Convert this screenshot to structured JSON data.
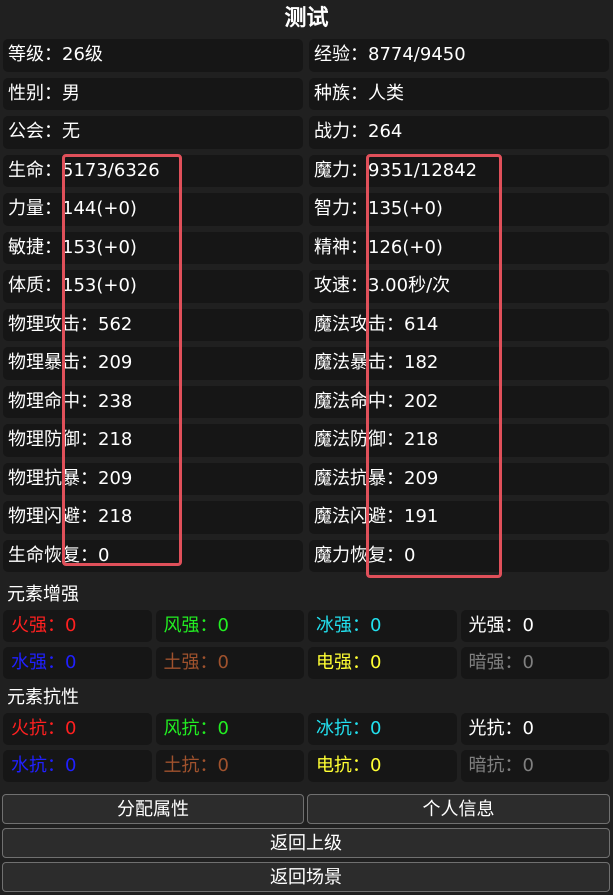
{
  "title": "测试",
  "stats": [
    [
      {
        "label": "等级",
        "value": "26级"
      },
      {
        "label": "经验",
        "value": "8774/9450"
      }
    ],
    [
      {
        "label": "性别",
        "value": "男"
      },
      {
        "label": "种族",
        "value": "人类"
      }
    ],
    [
      {
        "label": "公会",
        "value": "无"
      },
      {
        "label": "战力",
        "value": "264"
      }
    ],
    [
      {
        "label": "生命",
        "value": "5173/6326"
      },
      {
        "label": "魔力",
        "value": "9351/12842"
      }
    ],
    [
      {
        "label": "力量",
        "value": "144(+0)"
      },
      {
        "label": "智力",
        "value": "135(+0)"
      }
    ],
    [
      {
        "label": "敏捷",
        "value": "153(+0)"
      },
      {
        "label": "精神",
        "value": "126(+0)"
      }
    ],
    [
      {
        "label": "体质",
        "value": "153(+0)"
      },
      {
        "label": "攻速",
        "value": "3.00秒/次"
      }
    ],
    [
      {
        "label": "物理攻击",
        "value": "562"
      },
      {
        "label": "魔法攻击",
        "value": "614"
      }
    ],
    [
      {
        "label": "物理暴击",
        "value": "209"
      },
      {
        "label": "魔法暴击",
        "value": "182"
      }
    ],
    [
      {
        "label": "物理命中",
        "value": "238"
      },
      {
        "label": "魔法命中",
        "value": "202"
      }
    ],
    [
      {
        "label": "物理防御",
        "value": "218"
      },
      {
        "label": "魔法防御",
        "value": "218"
      }
    ],
    [
      {
        "label": "物理抗暴",
        "value": "209"
      },
      {
        "label": "魔法抗暴",
        "value": "209"
      }
    ],
    [
      {
        "label": "物理闪避",
        "value": "218"
      },
      {
        "label": "魔法闪避",
        "value": "191"
      }
    ],
    [
      {
        "label": "生命恢复",
        "value": "0"
      },
      {
        "label": "魔力恢复",
        "value": "0"
      }
    ]
  ],
  "separator": "：",
  "element_boost": {
    "title": "元素增强",
    "items": [
      {
        "label": "火强",
        "value": "0",
        "color": "#ff2020"
      },
      {
        "label": "风强",
        "value": "0",
        "color": "#22ee22"
      },
      {
        "label": "冰强",
        "value": "0",
        "color": "#22e0ee"
      },
      {
        "label": "光强",
        "value": "0",
        "color": "#ffffff"
      },
      {
        "label": "水强",
        "value": "0",
        "color": "#2020ff"
      },
      {
        "label": "土强",
        "value": "0",
        "color": "#a0522d"
      },
      {
        "label": "电强",
        "value": "0",
        "color": "#ffff33"
      },
      {
        "label": "暗强",
        "value": "0",
        "color": "#808080"
      }
    ]
  },
  "element_resist": {
    "title": "元素抗性",
    "items": [
      {
        "label": "火抗",
        "value": "0",
        "color": "#ff2020"
      },
      {
        "label": "风抗",
        "value": "0",
        "color": "#22ee22"
      },
      {
        "label": "冰抗",
        "value": "0",
        "color": "#22e0ee"
      },
      {
        "label": "光抗",
        "value": "0",
        "color": "#ffffff"
      },
      {
        "label": "水抗",
        "value": "0",
        "color": "#2020ff"
      },
      {
        "label": "土抗",
        "value": "0",
        "color": "#a0522d"
      },
      {
        "label": "电抗",
        "value": "0",
        "color": "#ffff33"
      },
      {
        "label": "暗抗",
        "value": "0",
        "color": "#808080"
      }
    ]
  },
  "buttons": {
    "allocate": "分配属性",
    "profile": "个人信息",
    "back": "返回上级",
    "scene": "返回场景"
  },
  "highlight_color": "#e0505a"
}
